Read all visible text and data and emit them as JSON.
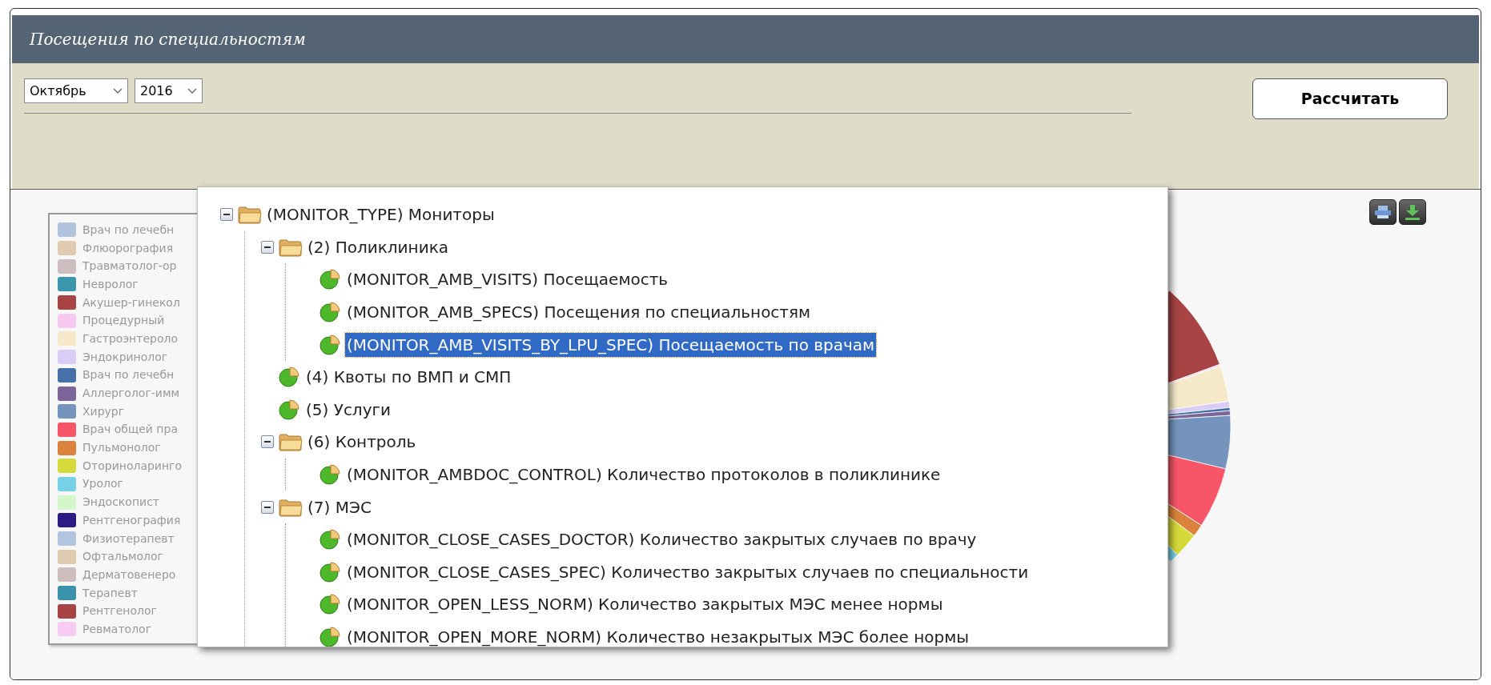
{
  "header": {
    "title": "Посещения по специальностям"
  },
  "filters": {
    "month": "Октябрь",
    "year": "2016",
    "calculate_button": "Рассчитать"
  },
  "legend": [
    {
      "label": "Врач по лечебн",
      "color": "#b0c4de"
    },
    {
      "label": "Флюорография",
      "color": "#e0cbb0"
    },
    {
      "label": "Травматолог-ор",
      "color": "#cdbfc0"
    },
    {
      "label": "Невролог",
      "color": "#3b95ad"
    },
    {
      "label": "Акушер-гинекол",
      "color": "#a84444"
    },
    {
      "label": "Процедурный",
      "color": "#f7c9f0"
    },
    {
      "label": "Гастроэнтероло",
      "color": "#f5e9c9"
    },
    {
      "label": "Эндокринолог",
      "color": "#d9ccf5"
    },
    {
      "label": "Врач по лечебн",
      "color": "#4570a8"
    },
    {
      "label": "Аллерголог-имм",
      "color": "#7a6499"
    },
    {
      "label": "Хирург",
      "color": "#7494bd"
    },
    {
      "label": "Врач общей пра",
      "color": "#f75669"
    },
    {
      "label": "Пульмонолог",
      "color": "#db833d"
    },
    {
      "label": "Оториноларинго",
      "color": "#d6d93a"
    },
    {
      "label": "Уролог",
      "color": "#77d1e6"
    },
    {
      "label": "Эндоскопист",
      "color": "#d3f7cb"
    },
    {
      "label": "Рентгенография",
      "color": "#2b1b85"
    },
    {
      "label": "Физиотерапевт",
      "color": "#b1c4e0"
    },
    {
      "label": "Офтальмолог",
      "color": "#e1cbb1"
    },
    {
      "label": "Дерматовенеро",
      "color": "#cdbdbd"
    },
    {
      "label": "Терапевт",
      "color": "#3a93ab"
    },
    {
      "label": "Рентгенолог",
      "color": "#a84343"
    },
    {
      "label": "Ревматолог",
      "color": "#f8cbf2"
    }
  ],
  "tree": [
    {
      "kind": "folder",
      "label": "(MONITOR_TYPE) Мониторы",
      "expanded": true,
      "children": [
        {
          "kind": "folder",
          "label": "(2) Поликлиника",
          "expanded": true,
          "children": [
            {
              "kind": "monitor",
              "label": "(MONITOR_AMB_VISITS) Посещаемость",
              "selected": false
            },
            {
              "kind": "monitor",
              "label": "(MONITOR_AMB_SPECS) Посещения по специальностям",
              "selected": false
            },
            {
              "kind": "monitor",
              "label": "(MONITOR_AMB_VISITS_BY_LPU_SPEC) Посещаемость по врачам",
              "selected": true
            }
          ]
        },
        {
          "kind": "monitor",
          "label": "(4) Квоты по ВМП и СМП",
          "selected": false
        },
        {
          "kind": "monitor",
          "label": "(5) Услуги",
          "selected": false
        },
        {
          "kind": "folder",
          "label": "(6) Контроль",
          "expanded": true,
          "children": [
            {
              "kind": "monitor",
              "label": "(MONITOR_AMBDOC_CONTROL) Количество протоколов в поликлинике",
              "selected": false
            }
          ]
        },
        {
          "kind": "folder",
          "label": "(7) МЭС",
          "expanded": true,
          "children": [
            {
              "kind": "monitor",
              "label": "(MONITOR_CLOSE_CASES_DOCTOR) Количество закрытых случаев по врачу",
              "selected": false
            },
            {
              "kind": "monitor",
              "label": "(MONITOR_CLOSE_CASES_SPEC) Количество закрытых случаев по специальности",
              "selected": false
            },
            {
              "kind": "monitor",
              "label": "(MONITOR_OPEN_LESS_NORM) Количество закрытых МЭС менее нормы",
              "selected": false
            },
            {
              "kind": "monitor",
              "label": "(MONITOR_OPEN_MORE_NORM) Количество незакрытых МЭС более нормы",
              "selected": false
            }
          ]
        }
      ]
    }
  ]
}
